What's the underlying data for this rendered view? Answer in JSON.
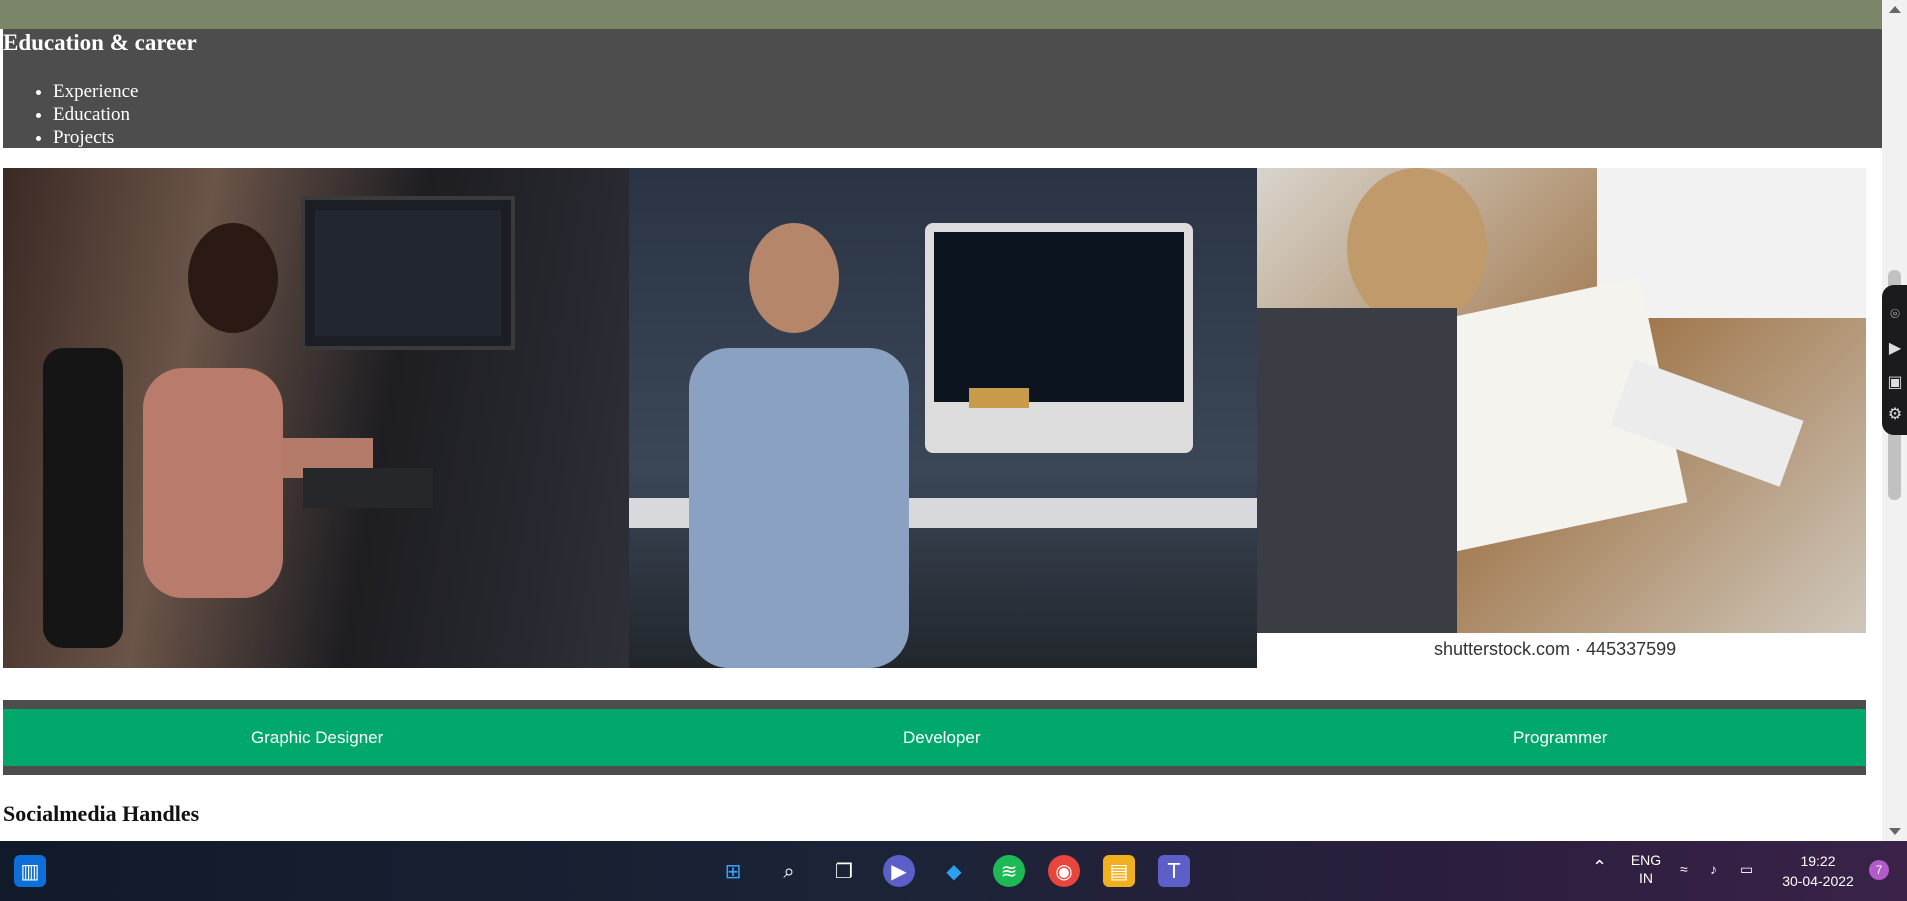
{
  "career": {
    "heading": "Education & career",
    "items": [
      "Experience",
      "Education",
      "Projects"
    ]
  },
  "photos": {
    "credit": "shutterstock.com · 445337599"
  },
  "roles": [
    "Graphic Designer",
    "Developer",
    "Programmer"
  ],
  "social": {
    "heading": "Socialmedia Handles"
  },
  "taskbar": {
    "lang": "ENG",
    "region": "IN",
    "time": "19:22",
    "date": "30-04-2022",
    "notification_count": "7"
  },
  "colors": {
    "topstrip": "#7b8568",
    "career_bg": "#4d4d4d",
    "role_green": "#00a86b"
  }
}
